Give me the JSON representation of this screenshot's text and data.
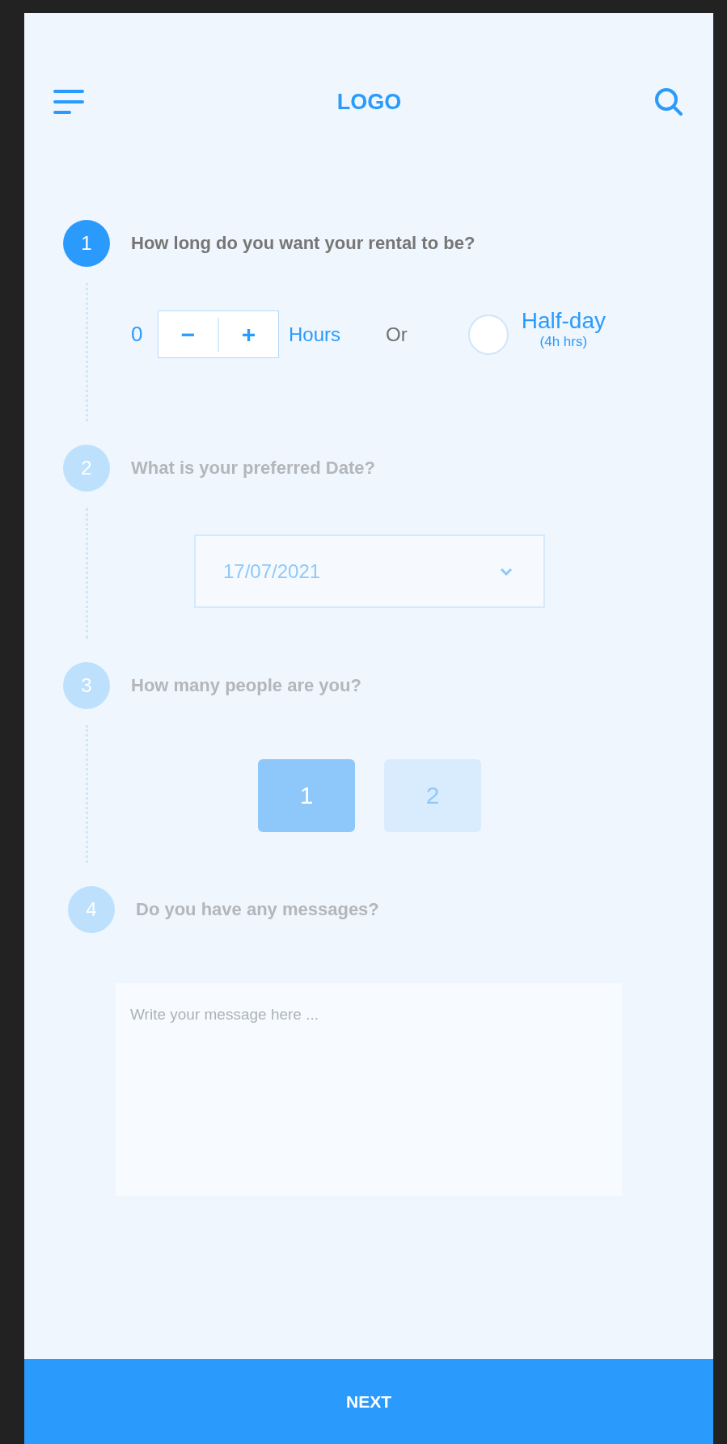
{
  "header": {
    "logo": "LOGO"
  },
  "steps": [
    {
      "kind": "duration",
      "number": "1",
      "question": "How long do you want your rental to be?",
      "active": true,
      "value": "0",
      "decrement": "−",
      "increment": "+",
      "unit": "Hours",
      "separator": "Or",
      "option": {
        "label": "Half-day",
        "note": "(4h hrs)",
        "selected": false
      }
    },
    {
      "kind": "date",
      "number": "2",
      "question": "What is your preferred Date?",
      "active": false,
      "value": "17/07/2021"
    },
    {
      "kind": "people",
      "number": "3",
      "question": "How many people are you?",
      "active": false,
      "options": [
        {
          "label": "1",
          "selected": true
        },
        {
          "label": "2",
          "selected": false
        }
      ]
    },
    {
      "kind": "message",
      "number": "4",
      "question": "Do you have any messages?",
      "active": false,
      "placeholder": "Write your message here ..."
    }
  ],
  "next_button": "NEXT"
}
